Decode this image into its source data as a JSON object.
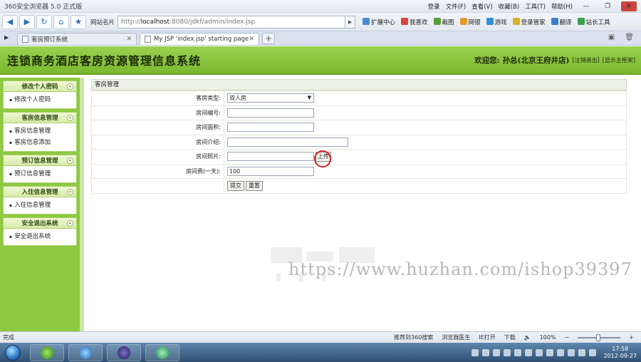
{
  "browser": {
    "title": "360安全浏览器 5.0 正式版",
    "menus": [
      "登录",
      "文件(F)",
      "查看(V)",
      "收藏(B)",
      "工具(T)",
      "帮助(H)"
    ],
    "bookmark_label": "网站名片",
    "address_prefix": "http://",
    "address_host": "localhost",
    "address_rest": ":8080/jdkf/admin/index.jsp",
    "tools": [
      "扩展中心",
      "我喜欢",
      "截图",
      "网银",
      "游戏",
      "登录管家",
      "翻译",
      "站长工具"
    ],
    "tabs": [
      {
        "label": "客房预订系统"
      },
      {
        "label": "My JSP 'index.jsp' starting page"
      }
    ],
    "status": {
      "left": "完成",
      "items": [
        "推荐到360搜索",
        "浏览器医生",
        "IE打开",
        "下载"
      ],
      "zoom": "100%"
    }
  },
  "app": {
    "title": "连锁商务酒店客房资源管理信息系统",
    "welcome_label": "欢迎您:",
    "user": "孙总(北京王府井店)",
    "logout_link": "[注销退出]",
    "panel_link": "[显示主框架]"
  },
  "sidebar": {
    "groups": [
      {
        "title": "修改个人密码",
        "items": [
          "修改个人密码"
        ]
      },
      {
        "title": "客房信息管理",
        "items": [
          "客房信息管理",
          "客房信息添加"
        ]
      },
      {
        "title": "预订信息管理",
        "items": [
          "预订信息管理"
        ]
      },
      {
        "title": "入住信息管理",
        "items": [
          "入住信息管理"
        ]
      },
      {
        "title": "安全退出系统",
        "items": [
          "安全退出系统"
        ]
      }
    ]
  },
  "form": {
    "panel_title": "客房管理",
    "room_type_label": "客房类型:",
    "room_type_value": "双人房",
    "room_no_label": "房间编号:",
    "room_no_value": "",
    "area_label": "房间面积:",
    "area_value": "",
    "intro_label": "房间介绍:",
    "intro_value": "",
    "photo_label": "房间照片:",
    "photo_value": "",
    "upload_label": "上传",
    "price_label": "房间费(一天):",
    "price_value": "100",
    "submit_label": "提交",
    "reset_label": "重置"
  },
  "watermark": "https://www.huzhan.com/ishop39397",
  "clock": {
    "time": "17:58",
    "date": "2012-09-27"
  }
}
